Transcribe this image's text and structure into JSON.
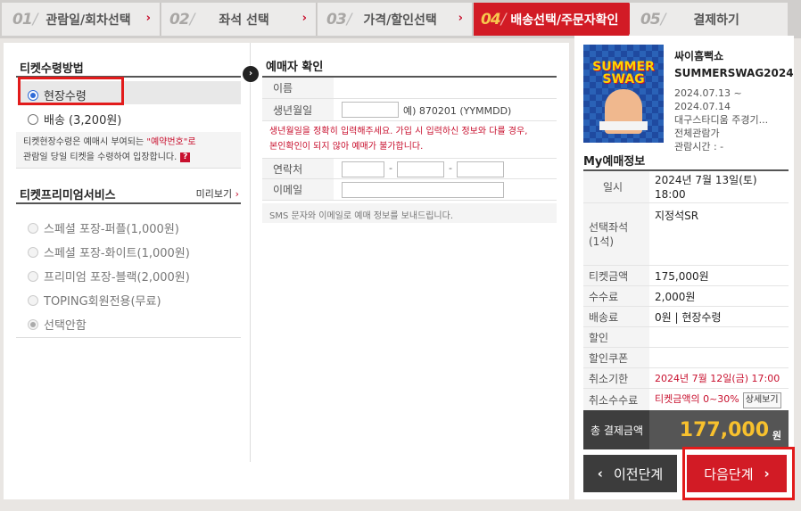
{
  "steps": [
    {
      "num": "01",
      "label": "관람일/회차선택"
    },
    {
      "num": "02",
      "label": "좌석 선택"
    },
    {
      "num": "03",
      "label": "가격/할인선택"
    },
    {
      "num": "04",
      "label": "배송선택/주문자확인"
    },
    {
      "num": "05",
      "label": "결제하기"
    }
  ],
  "pickup": {
    "title": "티켓수령방법",
    "options": [
      "현장수령",
      "배송 (3,200원)"
    ],
    "selected": "현장수령",
    "notice_pre": "티켓현장수령은 예매시 부여되는 ",
    "notice_accent": "\"예약번호\"",
    "notice_post": "로",
    "notice_line2": "관람일 당일 티켓을 수령하여 입장합니다.",
    "notice_icon": "?"
  },
  "premium": {
    "title": "티켓프리미엄서비스",
    "preview": "미리보기",
    "preview_arrow": "›",
    "options": [
      "스페셜 포장-퍼플(1,000원)",
      "스페셜 포장-화이트(1,000원)",
      "프리미엄 포장-블랙(2,000원)",
      "TOPING회원전용(무료)",
      "선택안함"
    ],
    "selected": "선택안함"
  },
  "booker": {
    "title": "예매자 확인",
    "name_label": "이름",
    "name_value": "",
    "birth_label": "생년월일",
    "birth_hint": "예) 870201 (YYMMDD)",
    "warn_line1": "생년월일을 정확히 입력해주세요. 가입 시 입력하신 정보와 다를 경우,",
    "warn_line2": "본인확인이 되지 않아 예매가 불가합니다.",
    "phone_label": "연락처",
    "phone_sep": "-",
    "email_label": "이메일",
    "sms_note": "SMS 문자와 이메일로 예매 정보를 보내드립니다."
  },
  "event": {
    "name_line1": "싸이흠뻑쇼",
    "name_line2": "SUMMERSWAG2024",
    "date_from": "2024.07.13 ~",
    "date_to": "2024.07.14",
    "venue": "대구스타디움 주경기...",
    "rating": "전체관람가",
    "runtime": "관람시간 : -",
    "poster_logo": "SUMMER SWAG"
  },
  "myinfo": {
    "title": "My예매정보",
    "rows": [
      {
        "k": "일시",
        "v": "2024년 7월 13일(토)",
        "v2": "18:00"
      },
      {
        "k": "선택좌석",
        "k2": "(1석)",
        "v": "지정석SR"
      },
      {
        "k": "티켓금액",
        "v": "175,000원"
      },
      {
        "k": "수수료",
        "v": "2,000원"
      },
      {
        "k": "배송료",
        "v": "0원 | 현장수령"
      },
      {
        "k": "할인",
        "v": ""
      },
      {
        "k": "할인쿠폰",
        "v": ""
      },
      {
        "k": "취소기한",
        "v": "2024년 7월 12일(금) 17:00"
      },
      {
        "k": "취소수수료",
        "v": "티켓금액의 0~30%",
        "btn": "상세보기"
      }
    ],
    "total_label": "총 결제금액",
    "total_value": "177,000",
    "total_unit": "원"
  },
  "nav": {
    "prev": "이전단계",
    "prev_arrow": "‹",
    "next": "다음단계",
    "next_arrow": "›",
    "step_arrow": "›"
  },
  "colors": {
    "accent": "#d21b25",
    "highlight": "#e21b1b",
    "total": "#f8c12d"
  }
}
